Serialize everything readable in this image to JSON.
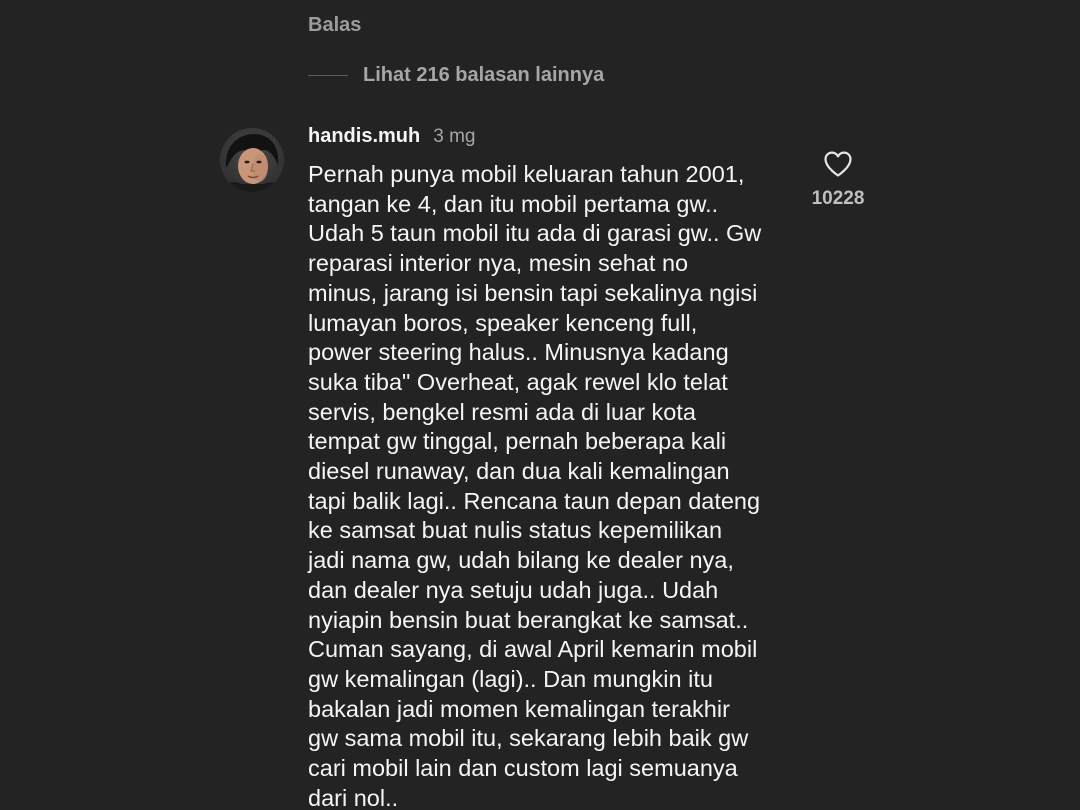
{
  "previous_reply": {
    "reply_label": "Balas"
  },
  "thread": {
    "view_more_replies": "Lihat 216 balasan lainnya"
  },
  "comment": {
    "username": "handis.muh",
    "timestamp": "3 mg",
    "like_count": "10228",
    "body_lines": [
      "Pernah punya mobil keluaran tahun 2001,",
      "tangan ke 4, dan itu mobil pertama gw..",
      "Udah 5 taun mobil itu ada di garasi gw.. Gw",
      "reparasi interior nya, mesin sehat no",
      "minus, jarang isi bensin tapi sekalinya ngisi",
      "lumayan boros, speaker kenceng full,",
      "power steering halus.. Minusnya kadang",
      "suka tiba\" Overheat, agak rewel klo telat",
      "servis, bengkel resmi ada di luar kota",
      "tempat gw tinggal, pernah beberapa kali",
      "diesel runaway, dan dua kali kemalingan",
      "tapi balik lagi.. Rencana taun depan dateng",
      "ke samsat buat nulis status kepemilikan",
      "jadi nama gw, udah bilang ke dealer nya,",
      "dan dealer nya setuju udah juga.. Udah",
      "nyiapin bensin buat berangkat ke samsat..",
      "Cuman sayang, di awal April kemarin mobil",
      "gw kemalingan (lagi).. Dan mungkin itu",
      "bakalan jadi momen kemalingan terakhir",
      "gw sama mobil itu, sekarang lebih baik gw",
      "cari mobil lain dan custom lagi semuanya",
      "dari nol.."
    ]
  },
  "icons": {
    "like": "heart-outline-icon"
  },
  "colors": {
    "background": "#232323",
    "text_primary": "#f5f5f5",
    "text_secondary": "#a6a6a6"
  }
}
